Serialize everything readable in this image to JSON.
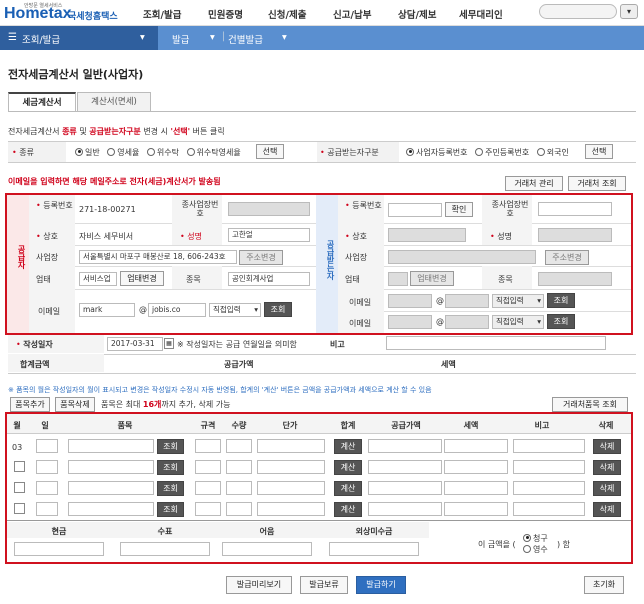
{
  "nav": {
    "logo": "Hometax",
    "logo_sub": "안방문 열세서비스",
    "logo_kr": "국세청홈택스",
    "menu": [
      "조회/발급",
      "민원증명",
      "신청/제출",
      "신고/납부",
      "상담/제보",
      "세무대리인"
    ]
  },
  "subnav": {
    "section": "조회/발급",
    "crumb1": "발급",
    "crumb2": "건별발급"
  },
  "page_title": "전자세금계산서 일반(사업자)",
  "tabs": [
    "세금계산서",
    "계산서(면세)"
  ],
  "notice1_a": "전자세금계산서 ",
  "notice1_b": "종류",
  "notice1_c": " 및 ",
  "notice1_d": "공급받는자구분",
  "notice1_e": " 변경 시 ",
  "notice1_f": "'선택'",
  "notice1_g": " 버튼 클릭",
  "kind": {
    "label": "종류",
    "options": [
      "일반",
      "영세율",
      "위수탁",
      "위수탁영세율"
    ],
    "selected": 0,
    "select_btn": "선택"
  },
  "buyer_type": {
    "label": "공급받는자구분",
    "options": [
      "사업자등록번호",
      "주민등록번호",
      "외국인"
    ],
    "selected": 0,
    "select_btn": "선택"
  },
  "email_warning": "이메일을 입력하면 해당 메일주소로 전자(세금)계산서가 발송됨",
  "btn_partner_manage": "거래처 관리",
  "btn_partner_search": "거래처 조회",
  "supplier": {
    "side_label": "공급자",
    "reg_no_label": "등록번호",
    "reg_no": "271-18-00271",
    "sub_biz_label": "종사업장번호",
    "name_label": "상호",
    "name": "자비스 세무비서",
    "rep_label": "성명",
    "rep": "고한얼",
    "addr_label": "사업장",
    "addr": "서울특별시 마포구 매봉산로 18, 606-243호",
    "addr_btn": "주소변경",
    "type_label": "업태",
    "type": "서비스업",
    "type_btn": "업태변경",
    "item_label": "종목",
    "item": "공인회계사업",
    "email_label": "이메일",
    "email_id": "mark",
    "email_domain": "jobis.co",
    "email_select": "직접입력",
    "search_btn": "조회"
  },
  "buyer": {
    "side_label": "공급받는자",
    "reg_no_label": "등록번호",
    "confirm_btn": "확인",
    "sub_biz_label": "종사업장번호",
    "name_label": "상호",
    "rep_label": "성명",
    "addr_label": "사업장",
    "addr_btn": "주소변경",
    "type_label": "업태",
    "type_btn": "업태변경",
    "item_label": "종목",
    "email_label": "이메일",
    "email_select": "직접입력",
    "search_btn": "조회",
    "email2_label": "이메일",
    "email2_select": "직접입력",
    "search2_btn": "조회"
  },
  "write_date": {
    "label": "작성일자",
    "value": "2017-03-31",
    "note": "※ 작성일자는 공급 연월일을 의미함",
    "memo_label": "비고"
  },
  "totals": {
    "total_label": "합계금액",
    "supply_label": "공급가액",
    "tax_label": "세액"
  },
  "items_note": "※ 품목의 월은 작성일자의 월이 표시되고 변경은 작성일자 수정시 자동 반영됨, 합계의 '계산' 버튼은 금액을 공급가액과 세액으로 계산 할 수 있음",
  "btn_add_item": "품목추가",
  "btn_del_item": "품목삭제",
  "items_limit_a": "품목은 최대 ",
  "items_limit_b": "16개",
  "items_limit_c": "까지 추가, 삭제 가능",
  "btn_partner_items": "거래처품목 조회",
  "item_table": {
    "headers": [
      "월",
      "일",
      "품목",
      "규격",
      "수량",
      "단가",
      "합계",
      "공급가액",
      "세액",
      "비고",
      "삭제"
    ],
    "rows": [
      {
        "month": "03",
        "search": "조회",
        "calc": "계산",
        "del": "삭제"
      },
      {
        "month": "",
        "search": "조회",
        "calc": "계산",
        "del": "삭제"
      },
      {
        "month": "",
        "search": "조회",
        "calc": "계산",
        "del": "삭제"
      },
      {
        "month": "",
        "search": "조회",
        "calc": "계산",
        "del": "삭제"
      }
    ]
  },
  "payment": {
    "headers": [
      "현금",
      "수표",
      "어음",
      "외상미수금"
    ],
    "amount_label_a": "이 금액을 (",
    "claim": "청구",
    "receipt": "영수",
    "amount_label_b": ") 함",
    "selected": "claim"
  },
  "bottom": {
    "preview": "발급미리보기",
    "hold": "발급보류",
    "issue": "발급하기",
    "reset": "초기화"
  },
  "colors": {
    "accent": "#2f6fc0",
    "red": "#d0111f",
    "nav": "#5a8fd0"
  }
}
